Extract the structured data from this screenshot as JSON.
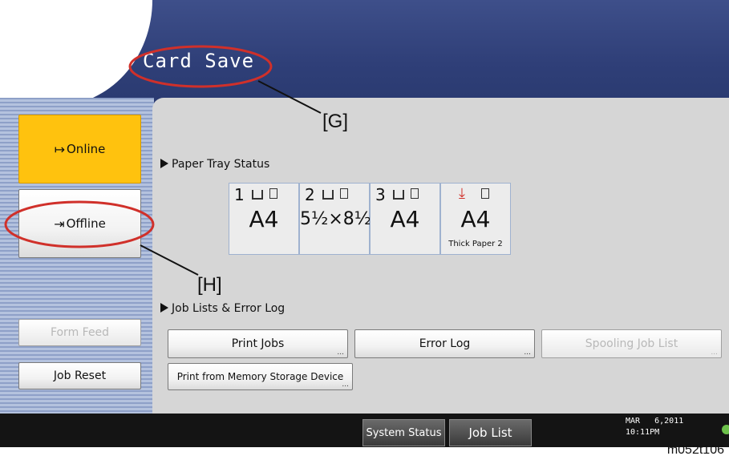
{
  "header": {
    "title": "Card Save"
  },
  "left_panel": {
    "online_label": "Online",
    "offline_label": "Offline",
    "form_feed_label": "Form Feed",
    "job_reset_label": "Job Reset"
  },
  "paper_tray": {
    "section_label": "Paper Tray Status",
    "trays": [
      {
        "number": "1",
        "size": "A4",
        "note": ""
      },
      {
        "number": "2",
        "size": "5½×8½",
        "note": ""
      },
      {
        "number": "3",
        "size": "A4",
        "note": ""
      },
      {
        "number": "",
        "size": "A4",
        "note": "Thick Paper 2"
      }
    ]
  },
  "job_lists": {
    "section_label": "Job Lists & Error Log",
    "print_jobs_label": "Print Jobs",
    "error_log_label": "Error Log",
    "spooling_job_list_label": "Spooling Job List",
    "print_from_memory_label": "Print from Memory Storage Device",
    "more_indicator": "..."
  },
  "bottom_bar": {
    "system_status_label": "System Status",
    "job_list_label": "Job List",
    "date": "MAR   6,2011",
    "time": "10:11PM"
  },
  "annotations": {
    "callout_g": "[G]",
    "callout_h": "[H]",
    "figure_code": "m052t106"
  },
  "colors": {
    "header_blue": "#2f3f78",
    "online_yellow": "#ffc20e",
    "callout_red": "#d0302a",
    "content_gray": "#d6d6d6"
  }
}
